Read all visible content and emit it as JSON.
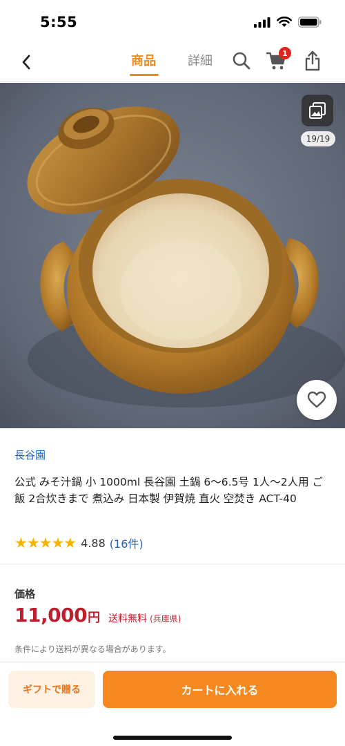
{
  "status_bar": {
    "time": "5:55"
  },
  "nav": {
    "tabs": [
      {
        "label": "商品",
        "active": true
      },
      {
        "label": "詳細",
        "active": false
      }
    ],
    "cart_badge": "1",
    "icons": [
      "back-chevron-icon",
      "search-icon",
      "cart-icon",
      "share-icon"
    ]
  },
  "gallery": {
    "counter": "19/19",
    "icons": [
      "gallery-icon",
      "heart-icon"
    ]
  },
  "product": {
    "shop_name": "長谷園",
    "title": "公式 みそ汁鍋 小 1000ml 長谷園 土鍋 6～6.5号 1人～2人用 ご飯 2合炊きまで 煮込み 日本製 伊賀焼 直火 空焚き ACT-40",
    "rating_stars": 5,
    "rating_value": "4.88",
    "review_count": "(16件)"
  },
  "price": {
    "label": "価格",
    "amount": "11,000",
    "currency": "円",
    "shipping_free": "送料無料",
    "shipping_region": "(兵庫県)",
    "shipping_note": "条件により送料が異なる場合があります。"
  },
  "actions": {
    "gift_label": "ギフトで贈る",
    "add_to_cart_label": "カートに入れる"
  },
  "colors": {
    "accent_orange": "#f5891f",
    "price_red": "#bf1e2e",
    "link_blue": "#1f5fbf",
    "star_yellow": "#f5b400"
  }
}
